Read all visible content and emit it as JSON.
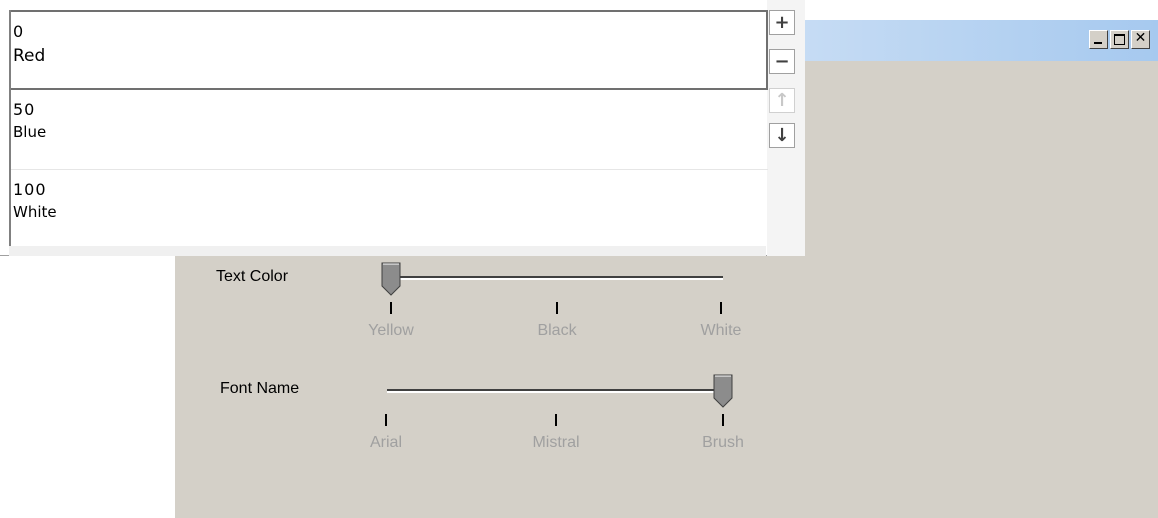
{
  "window": {
    "title": "",
    "minimize_symbol": "_",
    "maximize_symbol": "□",
    "close_symbol": "✕",
    "titlebar_color": "#a6c9ef",
    "background_color": "#d4d0c8"
  },
  "list": {
    "items": [
      {
        "value": "0",
        "name": "Red",
        "selected": true
      },
      {
        "value": "50",
        "name": "Blue",
        "selected": false
      },
      {
        "value": "100",
        "name": "White",
        "selected": false
      }
    ],
    "buttons": {
      "add": "+",
      "remove": "−",
      "move_up": "↑",
      "move_down": "↓"
    }
  },
  "sliders": {
    "text_color": {
      "label": "Text Color",
      "ticks": [
        "Yellow",
        "Black",
        "White"
      ],
      "value_index": 0
    },
    "font_name": {
      "label": "Font Name",
      "ticks": [
        "Arial",
        "Mistral",
        "Brush"
      ],
      "value_index": 2
    }
  }
}
